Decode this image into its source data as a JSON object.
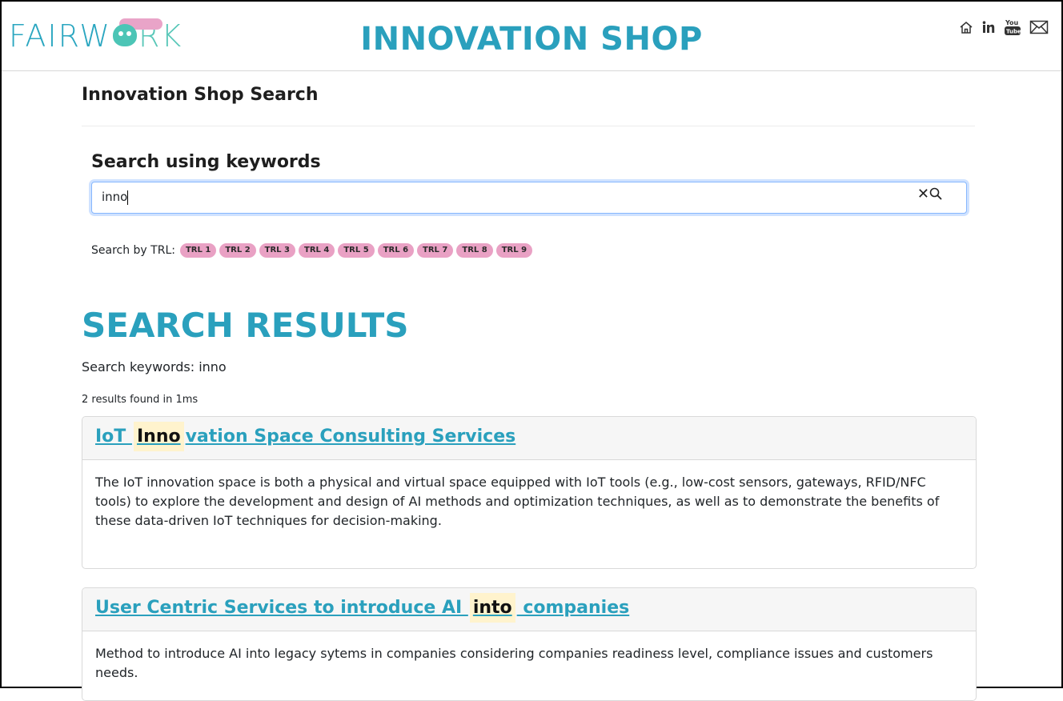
{
  "header": {
    "logo": {
      "part1": "FAIRW",
      "part2": "RK"
    },
    "title": "INNOVATION SHOP",
    "social": [
      "home-icon",
      "linkedin-icon",
      "youtube-icon",
      "mail-icon"
    ]
  },
  "page": {
    "heading": "Innovation Shop Search"
  },
  "search": {
    "title": "Search using keywords",
    "value": "inno",
    "trl_label": "Search by TRL:",
    "trl_badges": [
      "TRL 1",
      "TRL 2",
      "TRL 3",
      "TRL 4",
      "TRL 5",
      "TRL 6",
      "TRL 7",
      "TRL 8",
      "TRL 9"
    ]
  },
  "results": {
    "title": "SEARCH RESULTS",
    "keywords_line": "Search keywords: inno",
    "count_line": "2 results found in 1ms",
    "items": [
      {
        "title_pre": "IoT ",
        "title_hl": "Inno",
        "title_post": "vation Space Consulting Services",
        "description": "The IoT innovation space is both a physical and virtual space equipped with IoT tools (e.g., low-cost sensors, gateways, RFID/NFC tools) to explore the development and design of AI methods and optimization techniques, as well as to demonstrate the benefits of these data-driven IoT techniques for decision-making."
      },
      {
        "title_pre": "User Centric Services to introduce AI ",
        "title_hl": "into",
        "title_post": " companies",
        "description": "Method to introduce AI into legacy sytems in companies considering companies readiness level, compliance issues and customers needs."
      }
    ]
  }
}
